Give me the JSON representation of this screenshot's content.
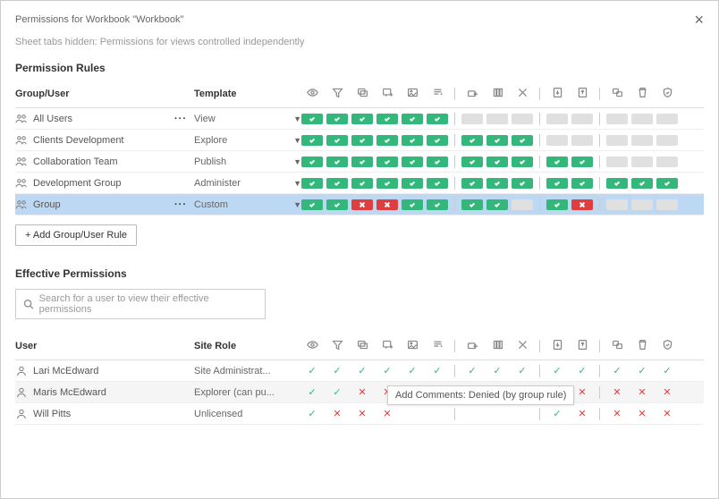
{
  "title": "Permissions for Workbook \"Workbook\"",
  "subtitle": "Sheet tabs hidden: Permissions for views controlled independently",
  "sections": {
    "rules_heading": "Permission Rules",
    "effective_heading": "Effective Permissions"
  },
  "headers": {
    "group_user": "Group/User",
    "template": "Template",
    "user": "User",
    "site_role": "Site Role"
  },
  "add_button": "+ Add Group/User Rule",
  "search_placeholder": "Search for a user to view their effective permissions",
  "tooltip": "Add Comments: Denied (by group rule)",
  "perm_columns": [
    "view",
    "filter",
    "view-comments",
    "add-comments",
    "download-image",
    "download-summary",
    "share",
    "web-edit",
    "download-full",
    "download-wb",
    "overwrite",
    "move",
    "delete",
    "set-permissions"
  ],
  "dividers_after": [
    5,
    8,
    10
  ],
  "rules": [
    {
      "name": "All Users",
      "template": "View",
      "showEllipsis": true,
      "selected": false,
      "hover": false,
      "perms": [
        "allow",
        "allow",
        "allow",
        "allow",
        "allow",
        "allow",
        "unset",
        "unset",
        "unset",
        "unset",
        "unset",
        "unset",
        "unset",
        "unset"
      ]
    },
    {
      "name": "Clients Development",
      "template": "Explore",
      "showEllipsis": false,
      "selected": false,
      "hover": false,
      "perms": [
        "allow",
        "allow",
        "allow",
        "allow",
        "allow",
        "allow",
        "allow",
        "allow",
        "allow",
        "unset",
        "unset",
        "unset",
        "unset",
        "unset"
      ]
    },
    {
      "name": "Collaboration Team",
      "template": "Publish",
      "showEllipsis": false,
      "selected": false,
      "hover": false,
      "perms": [
        "allow",
        "allow",
        "allow",
        "allow",
        "allow",
        "allow",
        "allow",
        "allow",
        "allow",
        "allow",
        "allow",
        "unset",
        "unset",
        "unset"
      ]
    },
    {
      "name": "Development Group",
      "template": "Administer",
      "showEllipsis": false,
      "selected": false,
      "hover": false,
      "perms": [
        "allow",
        "allow",
        "allow",
        "allow",
        "allow",
        "allow",
        "allow",
        "allow",
        "allow",
        "allow",
        "allow",
        "allow",
        "allow",
        "allow"
      ]
    },
    {
      "name": "Group",
      "template": "Custom",
      "showEllipsis": true,
      "selected": true,
      "hover": false,
      "perms": [
        "allow",
        "allow",
        "deny",
        "deny",
        "allow",
        "allow",
        "allow",
        "allow",
        "unset",
        "allow",
        "deny",
        "unset",
        "unset",
        "unset"
      ]
    }
  ],
  "users": [
    {
      "name": "Lari McEdward",
      "role": "Site Administrat...",
      "hover": false,
      "perms": [
        "allow",
        "allow",
        "allow",
        "allow",
        "allow",
        "allow",
        "allow",
        "allow",
        "allow",
        "allow",
        "allow",
        "allow",
        "allow",
        "allow"
      ]
    },
    {
      "name": "Maris McEdward",
      "role": "Explorer (can pu...",
      "hover": true,
      "perms": [
        "allow",
        "allow",
        "deny",
        "deny",
        "allow",
        "allow",
        "allow",
        "allow",
        "deny",
        "allow",
        "deny",
        "deny",
        "deny",
        "deny"
      ]
    },
    {
      "name": "Will Pitts",
      "role": "Unlicensed",
      "hover": false,
      "perms": [
        "allow",
        "deny",
        "deny",
        "deny",
        "",
        "",
        "",
        "",
        "",
        "allow",
        "deny",
        "deny",
        "deny",
        "deny"
      ]
    }
  ]
}
